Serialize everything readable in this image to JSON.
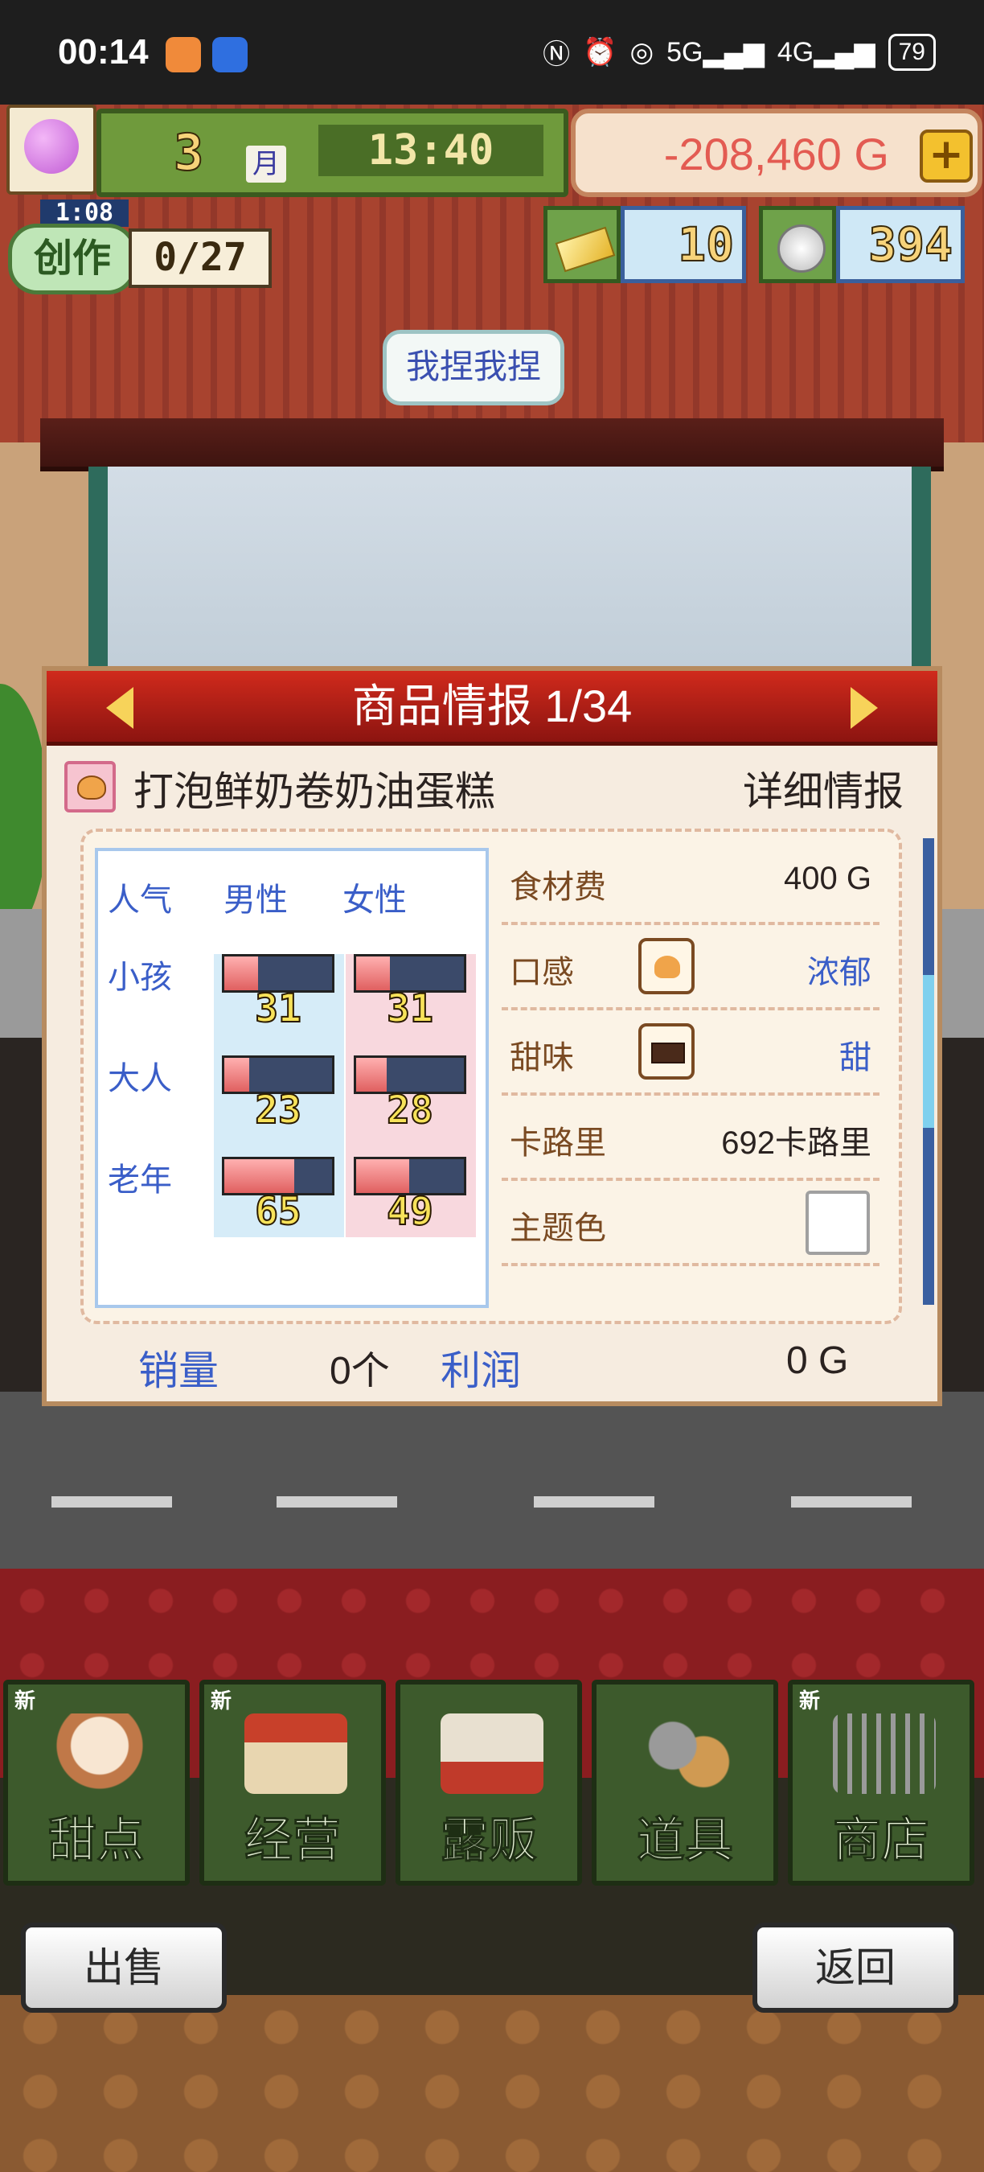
{
  "status_bar": {
    "time": "00:14",
    "icons": [
      "nfc-icon",
      "alarm-icon",
      "hotspot-icon",
      "5g-signal-icon",
      "4g-signal-icon"
    ],
    "network_5g": "5G",
    "network_4g": "4G",
    "battery": "79"
  },
  "hud": {
    "month_number": "3",
    "month_label": "月",
    "clock": "13:40",
    "money": "-208,460 G",
    "add_label": "+",
    "create_timer": "1:08",
    "create_label": "创作",
    "create_count": "0/27",
    "gold_count": "10",
    "silver_count": "394"
  },
  "speech_bubble": "我捏我捏",
  "panel": {
    "title": "商品情报 1/34",
    "item_name": "打泡鲜奶卷奶油蛋糕",
    "detail_link": "详细情报",
    "popularity": {
      "header": "人气",
      "male": "男性",
      "female": "女性",
      "rows": [
        {
          "label": "小孩",
          "male": 31,
          "female": 31
        },
        {
          "label": "大人",
          "male": 23,
          "female": 28
        },
        {
          "label": "老年",
          "male": 65,
          "female": 49
        }
      ]
    },
    "stats": {
      "cost_label": "食材费",
      "cost_value": "400 G",
      "texture_label": "口感",
      "texture_value": "浓郁",
      "sweet_label": "甜味",
      "sweet_value": "甜",
      "calorie_label": "卡路里",
      "calorie_value": "692卡路里",
      "theme_label": "主题色"
    },
    "sales_label": "销量",
    "sales_value": "0个",
    "profit_label": "利润",
    "profit_value": "0 G"
  },
  "menu": {
    "new_badge": "新",
    "items": [
      {
        "label": "甜点",
        "new": true
      },
      {
        "label": "经营",
        "new": true
      },
      {
        "label": "露贩",
        "new": false
      },
      {
        "label": "道具",
        "new": false
      },
      {
        "label": "商店",
        "new": true
      }
    ]
  },
  "bottom": {
    "sell": "出售",
    "back": "返回"
  },
  "colors": {
    "panel_header": "#c0281c",
    "accent_blue": "#3a5ec8",
    "money_red": "#e35b52",
    "menu_green": "#3d5a2c"
  }
}
